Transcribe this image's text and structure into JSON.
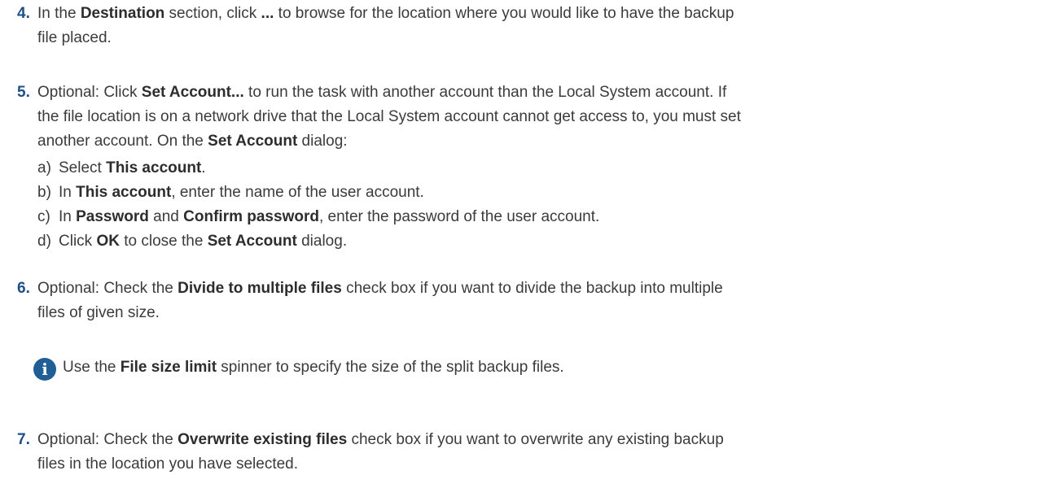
{
  "step4": {
    "num": "4.",
    "t1": "In the ",
    "b1": "Destination",
    "t2": " section, click ",
    "b2": "...",
    "t3": " to browse for the location where you would like to have the backup",
    "line2": "file placed."
  },
  "step5": {
    "num": "5.",
    "l1_t1": "Optional: Click ",
    "l1_b1": "Set Account...",
    "l1_t2": " to run the task with another account than the Local System account. If",
    "line2": "the file location is on a network drive that the Local System account cannot get access to, you must set",
    "l3_t1": "another account. On the ",
    "l3_b1": "Set Account",
    "l3_t2": " dialog:",
    "subs": {
      "a": {
        "lbl": "a)",
        "t1": "Select ",
        "b1": "This account",
        "t2": "."
      },
      "b": {
        "lbl": "b)",
        "t1": "In ",
        "b1": "This account",
        "t2": ", enter the name of the user account."
      },
      "c": {
        "lbl": "c)",
        "t1": "In ",
        "b1": "Password",
        "t2": " and ",
        "b2": "Confirm password",
        "t3": ", enter the password of the user account."
      },
      "d": {
        "lbl": "d)",
        "t1": "Click ",
        "b1": "OK",
        "t2": " to close the ",
        "b2": "Set Account",
        "t3": " dialog."
      }
    }
  },
  "step6": {
    "num": "6.",
    "t1": "Optional: Check the ",
    "b1": "Divide to multiple files",
    "t2": " check box if you want to divide the backup into multiple",
    "line2": "files of given size.",
    "note": {
      "icon": "info-icon",
      "glyph": "i",
      "t1": "Use the ",
      "b1": "File size limit",
      "t2": " spinner to specify the size of the split backup files."
    }
  },
  "step7": {
    "num": "7.",
    "t1": "Optional: Check the ",
    "b1": "Overwrite existing files",
    "t2": " check box if you want to overwrite any existing backup",
    "line2": "files in the location you have selected."
  },
  "colors": {
    "step_number": "#1e4f87",
    "info_icon": "#1f5f95",
    "text": "#3b3b3b"
  }
}
